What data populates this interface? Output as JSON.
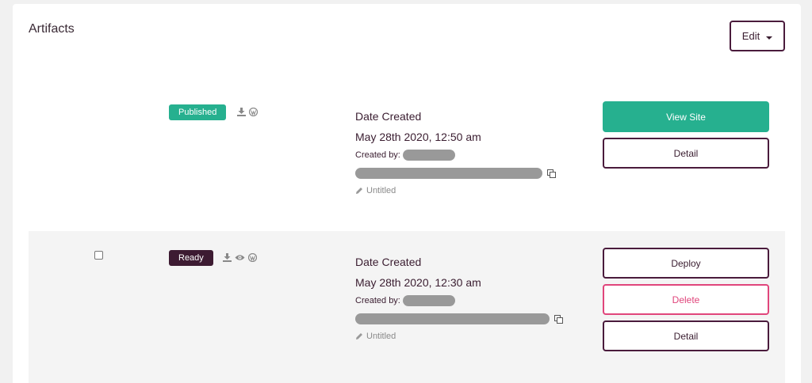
{
  "card": {
    "title": "Artifacts"
  },
  "toolbar": {
    "edit_label": "Edit"
  },
  "artifacts": [
    {
      "status": "Published",
      "status_color": "#26b08f",
      "icons": [
        "download-icon",
        "wordpress-icon"
      ],
      "date_label": "Date Created",
      "date_value": "May 28th 2020, 12:50 am",
      "created_by_label": "Created by:",
      "name": "Untitled",
      "actions": [
        {
          "label": "View Site",
          "style": "primary"
        },
        {
          "label": "Detail",
          "style": "outline"
        }
      ]
    },
    {
      "status": "Ready",
      "status_color": "#3d1b32",
      "icons": [
        "download-icon",
        "eye-icon",
        "wordpress-icon"
      ],
      "date_label": "Date Created",
      "date_value": "May 28th 2020, 12:30 am",
      "created_by_label": "Created by:",
      "name": "Untitled",
      "actions": [
        {
          "label": "Deploy",
          "style": "outline"
        },
        {
          "label": "Delete",
          "style": "danger"
        },
        {
          "label": "Detail",
          "style": "outline"
        }
      ]
    }
  ],
  "colors": {
    "accent": "#26b08f",
    "brand": "#4a1b3c",
    "danger": "#e0457b"
  }
}
